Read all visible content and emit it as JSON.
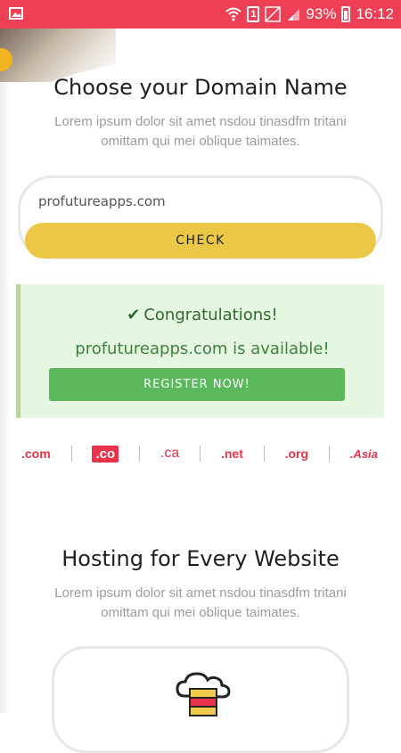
{
  "status_bar": {
    "battery": "93%",
    "time": "16:12",
    "sim": "1"
  },
  "domain": {
    "title": "Choose your Domain Name",
    "subtitle": "Lorem ipsum dolor sit amet nsdou tinasdfm tritani omittam qui mei oblique taimates.",
    "input_value": "profutureapps.com",
    "check_label": "CHECK"
  },
  "result": {
    "congrats": "Congratulations!",
    "available": "profutureapps.com is available!",
    "register_label": "REGISTER NOW!"
  },
  "tlds": [
    ".com",
    ".co",
    ".ca",
    ".net",
    ".org",
    ".Asia"
  ],
  "hosting": {
    "title": "Hosting for Every Website",
    "subtitle": "Lorem ipsum dolor sit amet nsdou tinasdfm tritani omittam qui mei oblique taimates."
  },
  "colors": {
    "status_bar": "#ee3f54",
    "check_button": "#ebc746",
    "result_bg": "#e5f7e0",
    "register_button": "#5cb85c",
    "tld_red": "#e8334a"
  }
}
